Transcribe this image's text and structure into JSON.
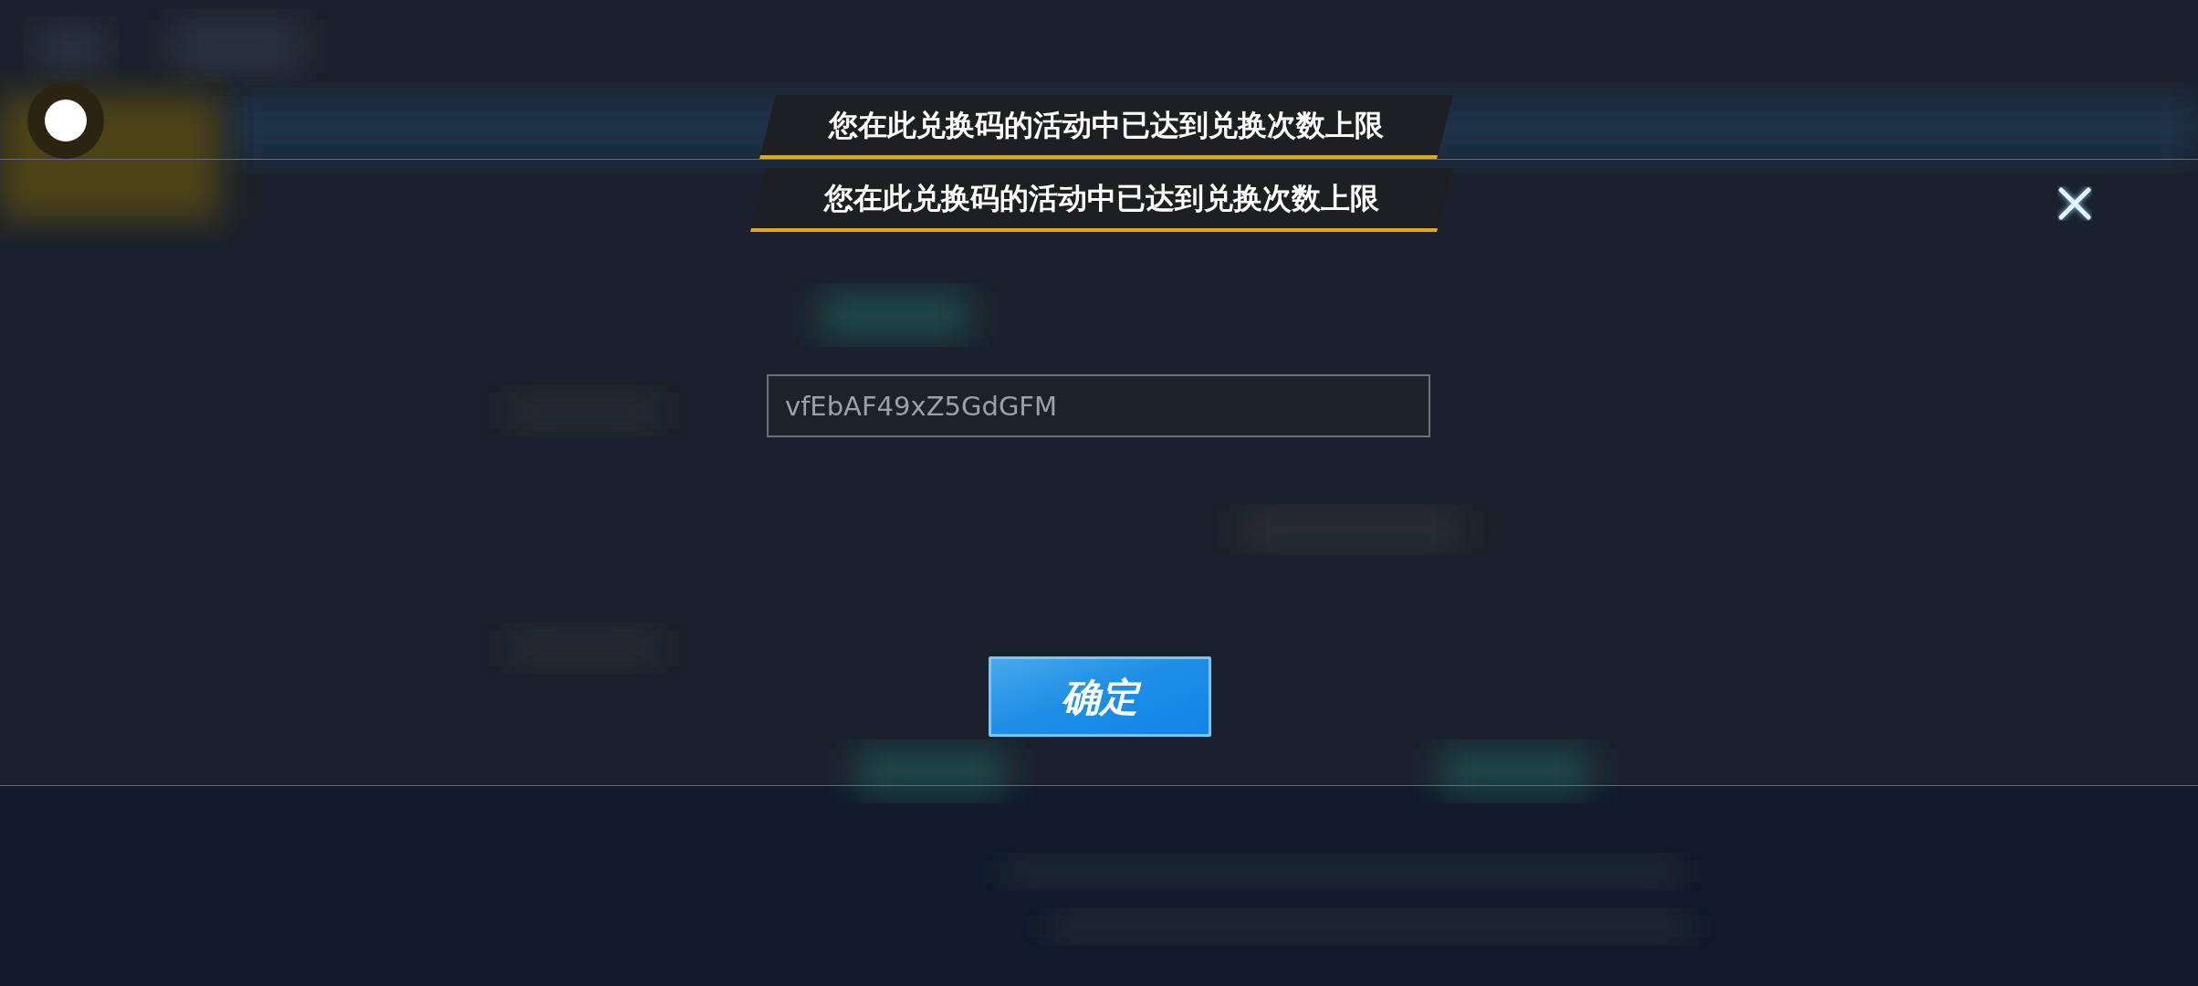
{
  "toasts": [
    {
      "text": "您在此兑换码的活动中已达到兑换次数上限"
    },
    {
      "text": "您在此兑换码的活动中已达到兑换次数上限"
    }
  ],
  "code_field": {
    "value": "vfEbAF49xZ5GdGFM"
  },
  "confirm_button": {
    "label": "确定"
  }
}
